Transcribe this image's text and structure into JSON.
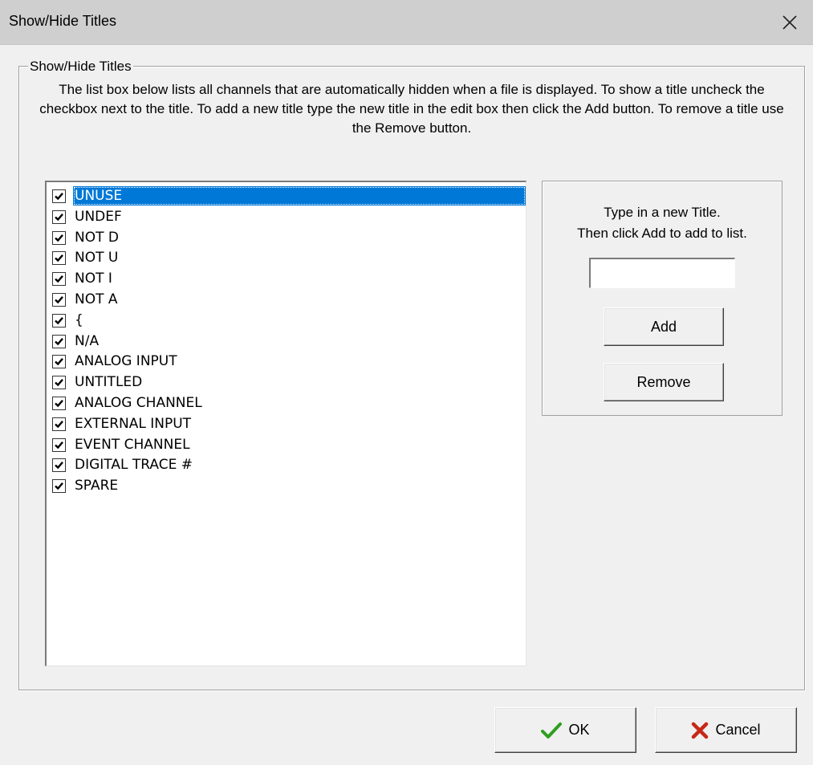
{
  "window": {
    "title": "Show/Hide Titles"
  },
  "group": {
    "label": "Show/Hide Titles",
    "description": "The list box below lists all channels that are automatically hidden when a file is displayed. To show a title uncheck the checkbox next to the title. To add a new title type the new title in the edit box then click the Add button. To remove a title use the Remove button."
  },
  "titles": [
    {
      "label": "UNUSE",
      "checked": true,
      "selected": true
    },
    {
      "label": "UNDEF",
      "checked": true
    },
    {
      "label": "NOT D",
      "checked": true
    },
    {
      "label": "NOT U",
      "checked": true
    },
    {
      "label": "NOT I",
      "checked": true
    },
    {
      "label": "NOT A",
      "checked": true
    },
    {
      "label": "{",
      "checked": true
    },
    {
      "label": "N/A",
      "checked": true
    },
    {
      "label": "ANALOG INPUT",
      "checked": true
    },
    {
      "label": "UNTITLED",
      "checked": true
    },
    {
      "label": "ANALOG CHANNEL",
      "checked": true
    },
    {
      "label": "EXTERNAL INPUT",
      "checked": true
    },
    {
      "label": "EVENT CHANNEL",
      "checked": true
    },
    {
      "label": "DIGITAL TRACE #",
      "checked": true
    },
    {
      "label": "SPARE",
      "checked": true
    }
  ],
  "add_panel": {
    "instruction_line1": "Type in a new Title.",
    "instruction_line2": "Then click Add to add to list.",
    "new_title_value": "",
    "add_label": "Add",
    "remove_label": "Remove"
  },
  "buttons": {
    "ok_label": "OK",
    "ok_icon": "checkmark-icon",
    "ok_icon_color": "#2e9e1f",
    "cancel_label": "Cancel",
    "cancel_icon": "x-icon",
    "cancel_icon_color": "#c62818"
  },
  "colors": {
    "selection": "#0078d7",
    "window_bg": "#f0f0f0",
    "titlebar_bg": "#cfcfcf"
  }
}
